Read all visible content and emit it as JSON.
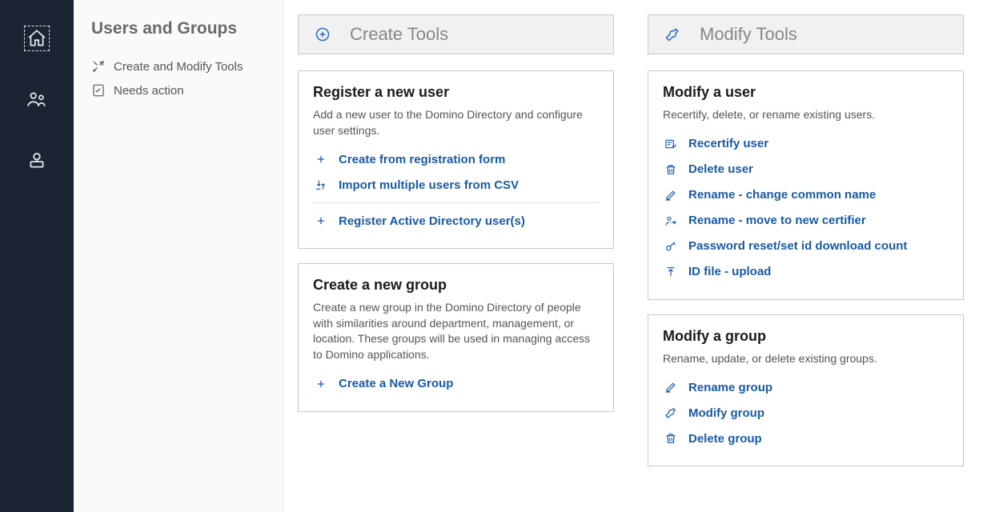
{
  "rail": {
    "items": [
      {
        "name": "home-icon",
        "selected": true
      },
      {
        "name": "users-icon",
        "selected": false
      },
      {
        "name": "machine-icon",
        "selected": false
      }
    ]
  },
  "sidepanel": {
    "title": "Users and Groups",
    "items": [
      {
        "icon": "tools-icon",
        "label": "Create and Modify Tools"
      },
      {
        "icon": "checklist-icon",
        "label": "Needs action"
      }
    ]
  },
  "columns": {
    "create": {
      "header_icon": "plus-circle-icon",
      "title": "Create Tools",
      "cards": [
        {
          "title": "Register a new user",
          "desc": "Add a new user to the Domino Directory and configure user settings.",
          "actions": [
            {
              "icon": "plus-icon",
              "label": "Create from registration form"
            },
            {
              "icon": "import-icon",
              "label": "Import multiple users from CSV"
            }
          ],
          "divider": true,
          "actions_after": [
            {
              "icon": "plus-icon",
              "label": "Register Active Directory user(s)"
            }
          ]
        },
        {
          "title": "Create a new group",
          "desc": "Create a new group in the Domino Directory of people with similarities around department, management, or location.  These groups will be used in managing access to Domino applications.",
          "actions": [
            {
              "icon": "plus-icon",
              "label": "Create a New Group"
            }
          ]
        }
      ]
    },
    "modify": {
      "header_icon": "wrench-icon",
      "title": "Modify Tools",
      "cards": [
        {
          "title": "Modify a user",
          "desc": "Recertify, delete, or rename existing users.",
          "actions": [
            {
              "icon": "recertify-icon",
              "label": "Recertify user"
            },
            {
              "icon": "trash-icon",
              "label": "Delete user"
            },
            {
              "icon": "pencil-icon",
              "label": "Rename - change common name"
            },
            {
              "icon": "person-move-icon",
              "label": "Rename - move to new certifier"
            },
            {
              "icon": "key-icon",
              "label": "Password reset/set id download count"
            },
            {
              "icon": "upload-icon",
              "label": "ID file - upload"
            }
          ]
        },
        {
          "title": "Modify a group",
          "desc": "Rename, update, or delete existing groups.",
          "actions": [
            {
              "icon": "pencil-icon",
              "label": "Rename group"
            },
            {
              "icon": "wrench-icon",
              "label": "Modify group"
            },
            {
              "icon": "trash-icon",
              "label": "Delete group"
            }
          ]
        }
      ]
    }
  }
}
